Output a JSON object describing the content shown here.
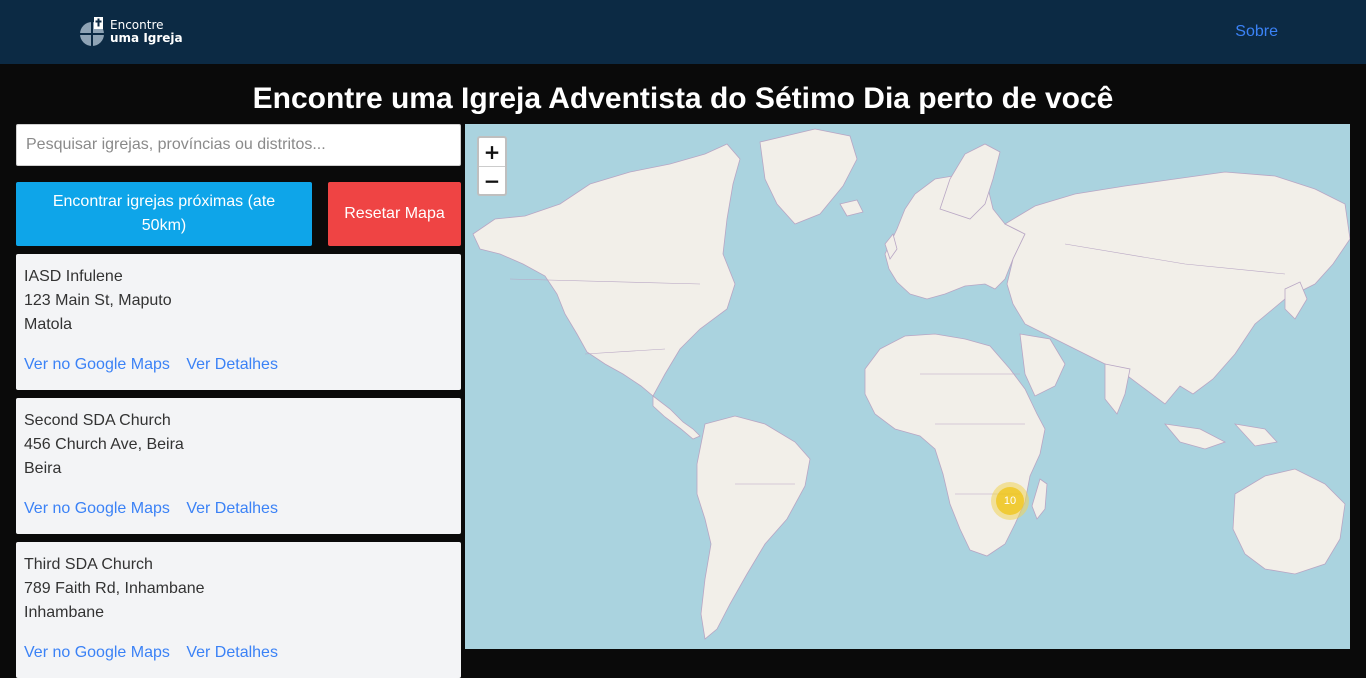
{
  "brand": {
    "line1": "Encontre",
    "line2": "uma Igreja"
  },
  "nav": {
    "about": "Sobre"
  },
  "headline": "Encontre uma Igreja Adventista do Sétimo Dia perto de você",
  "search": {
    "placeholder": "Pesquisar igrejas, províncias ou distritos...",
    "value": ""
  },
  "buttons": {
    "nearby": "Encontrar igrejas próximas (ate 50km)",
    "reset": "Resetar Mapa"
  },
  "churches": [
    {
      "name": "IASD Infulene",
      "address": "123 Main St, Maputo",
      "city": "Matola",
      "maps_link": "Ver no Google Maps",
      "details_link": "Ver Detalhes"
    },
    {
      "name": "Second SDA Church",
      "address": "456 Church Ave, Beira",
      "city": "Beira",
      "maps_link": "Ver no Google Maps",
      "details_link": "Ver Detalhes"
    },
    {
      "name": "Third SDA Church",
      "address": "789 Faith Rd, Inhambane",
      "city": "Inhambane",
      "maps_link": "Ver no Google Maps",
      "details_link": "Ver Detalhes"
    }
  ],
  "map": {
    "zoom_in": "+",
    "zoom_out": "−",
    "cluster_count": "10",
    "colors": {
      "water": "#aad3df",
      "land": "#f2efe9",
      "border": "#b8a6c4",
      "cluster": "#f0c20c"
    }
  }
}
